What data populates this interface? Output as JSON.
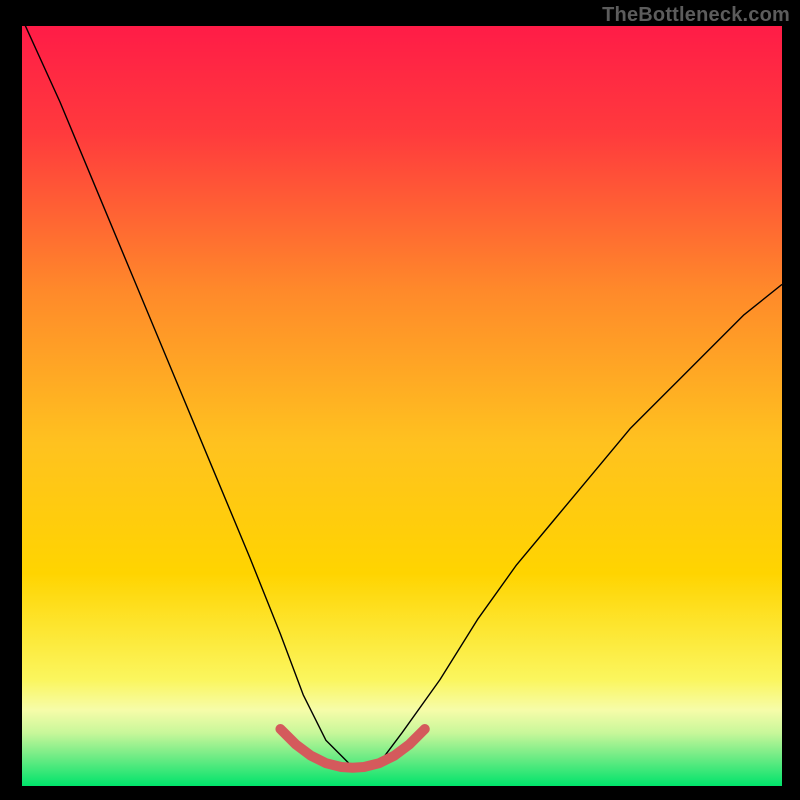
{
  "watermark": "TheBottleneck.com",
  "chart_data": {
    "type": "line",
    "title": "",
    "xlabel": "",
    "ylabel": "",
    "xlim": [
      0,
      100
    ],
    "ylim": [
      0,
      100
    ],
    "legend": false,
    "background_gradient_top": "#ff1c47",
    "background_gradient_mid": "#ffd400",
    "background_gradient_bottom": "#00e36b",
    "green_band_start_y": 10,
    "series": [
      {
        "name": "black-curve",
        "color": "#000000",
        "width": 1.4,
        "x": [
          0,
          5,
          10,
          15,
          20,
          25,
          30,
          34,
          37,
          40,
          43.5,
          47,
          50,
          55,
          60,
          65,
          70,
          75,
          80,
          85,
          90,
          95,
          100
        ],
        "values": [
          101,
          90,
          78,
          66,
          54,
          42,
          30,
          20,
          12,
          6,
          2.5,
          3,
          7,
          14,
          22,
          29,
          35,
          41,
          47,
          52,
          57,
          62,
          66
        ]
      },
      {
        "name": "red-highlight",
        "color": "#d45a5c",
        "width": 10,
        "linecap": "round",
        "x": [
          34,
          36,
          38,
          40,
          42,
          43.5,
          45,
          47,
          49,
          51,
          53
        ],
        "values": [
          7.5,
          5.5,
          4.0,
          3.0,
          2.5,
          2.4,
          2.5,
          3.0,
          4.0,
          5.5,
          7.5
        ]
      }
    ]
  }
}
